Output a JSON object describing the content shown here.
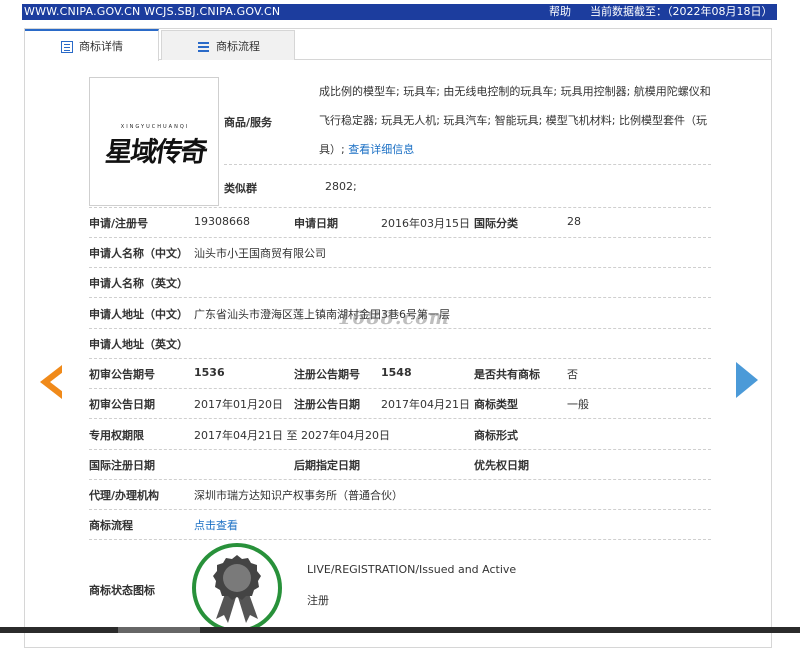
{
  "header": {
    "site_url": "WWW.CNIPA.GOV.CN WCJS.SBJ.CNIPA.GOV.CN",
    "help": "帮助",
    "data_date": "当前数据截至：（2022年08月18日）"
  },
  "tabs": [
    {
      "label": "商标详情",
      "active": true
    },
    {
      "label": "商标流程",
      "active": false
    }
  ],
  "logo": {
    "pinyin": "XINGYUCHUANQI",
    "text": "星域传奇"
  },
  "goods": {
    "label": "商品/服务",
    "text": "成比例的模型车; 玩具车; 由无线电控制的玩具车; 玩具用控制器; 航模用陀螺仪和飞行稳定器; 玩具无人机; 玩具汽车; 智能玩具; 模型飞机材料; 比例模型套件（玩具）;",
    "more_link": "查看详细信息"
  },
  "similar_group": {
    "label": "类似群",
    "value": "2802;"
  },
  "fields": {
    "reg_no_label": "申请/注册号",
    "reg_no": "19308668",
    "apply_date_label": "申请日期",
    "apply_date": "2016年03月15日",
    "intl_class_label": "国际分类",
    "intl_class": "28",
    "applicant_cn_label": "申请人名称（中文）",
    "applicant_cn": "汕头市小王国商贸有限公司",
    "applicant_en_label": "申请人名称（英文）",
    "applicant_en": "",
    "address_cn_label": "申请人地址（中文）",
    "address_cn": "广东省汕头市澄海区莲上镇南湖村金田3巷6号第一层",
    "address_en_label": "申请人地址（英文）",
    "address_en": "",
    "prelim_issue_label": "初审公告期号",
    "prelim_issue": "1536",
    "reg_issue_label": "注册公告期号",
    "reg_issue": "1548",
    "shared_label": "是否共有商标",
    "shared": "否",
    "prelim_date_label": "初审公告日期",
    "prelim_date": "2017年01月20日",
    "reg_date_label": "注册公告日期",
    "reg_date": "2017年04月21日",
    "mark_type_label": "商标类型",
    "mark_type": "一般",
    "exclusive_label": "专用权期限",
    "exclusive": "2017年04月21日 至 2027年04月20日",
    "mark_form_label": "商标形式",
    "mark_form": "",
    "intl_reg_date_label": "国际注册日期",
    "intl_reg_date": "",
    "later_date_label": "后期指定日期",
    "later_date": "",
    "priority_label": "优先权日期",
    "priority": "",
    "agent_label": "代理/办理机构",
    "agent": "深圳市瑞方达知识产权事务所（普通合伙）",
    "process_label": "商标流程",
    "process_link": "点击查看",
    "status_label": "商标状态图标",
    "status_en": "LIVE/REGISTRATION/Issued and Active",
    "status_cn": "注册"
  },
  "watermark": "1688.com",
  "colors": {
    "header_bg": "#1c3d9e",
    "link": "#1a6fc4",
    "arrow_left": "#f08a1a",
    "arrow_right": "#4b9ad8",
    "badge_ring": "#28913a"
  }
}
